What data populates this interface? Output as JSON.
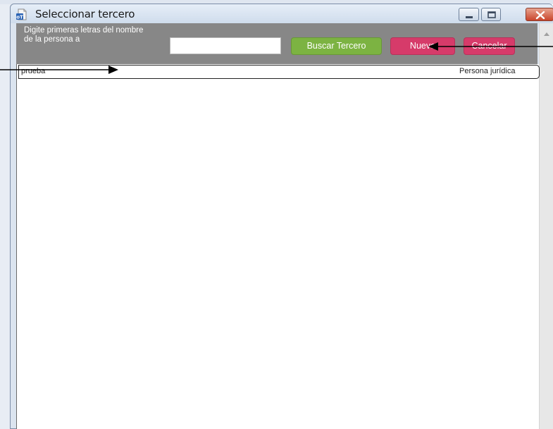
{
  "window": {
    "title": "Seleccionar tercero",
    "icon": "document-person-icon",
    "controls": [
      "minimize-icon",
      "maximize-icon",
      "close-icon"
    ]
  },
  "toolbar": {
    "label": "Digite primeras letras del nombre de la persona a",
    "search_value": "",
    "search_placeholder": "",
    "buscar_label": "Buscar Tercero",
    "nuevo_label": "Nuevo",
    "cancelar_label": "Cancelar"
  },
  "list": {
    "rows": [
      {
        "name": "prueba",
        "type": "Persona jurídica"
      }
    ]
  },
  "colors": {
    "toolbar_bg": "#878787",
    "buscar_button": "#7cb342",
    "nuevo_button": "#d63b6a",
    "cancelar_button": "#d63b6a",
    "close_button": "#c9452b"
  }
}
